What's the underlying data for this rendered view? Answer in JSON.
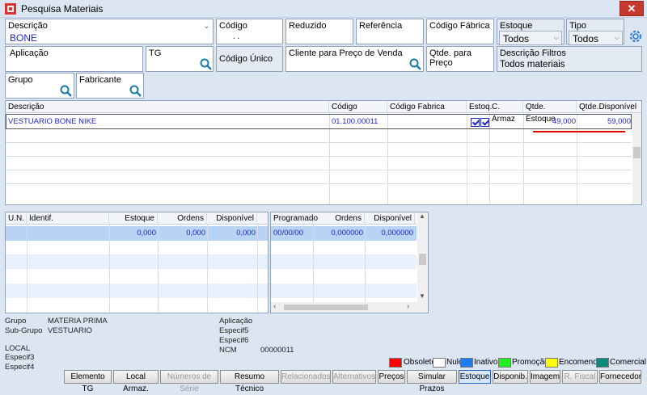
{
  "window": {
    "title": "Pesquisa Materiais",
    "close": "✕"
  },
  "filters": {
    "descricao": {
      "label": "Descrição",
      "value": "BONE"
    },
    "codigo": {
      "label": "Código",
      "value": ". ."
    },
    "reduzido": {
      "label": "Reduzido"
    },
    "referencia": {
      "label": "Referência"
    },
    "codigo_fabrica": {
      "label": "Código Fábrica"
    },
    "estoque": {
      "label": "Estoque",
      "value": "Todos"
    },
    "tipo": {
      "label": "Tipo",
      "value": "Todos"
    },
    "aplicacao": {
      "label": "Aplicação"
    },
    "tg": {
      "label": "TG"
    },
    "codigo_unico": {
      "label": "Código Único"
    },
    "cliente_preco": {
      "label": "Cliente para Preço de Venda"
    },
    "qtde_preco": {
      "label": "Qtde. para Preço"
    },
    "descricao_filtros": {
      "label": "Descrição Filtros",
      "value": "Todos materiais"
    },
    "grupo": {
      "label": "Grupo"
    },
    "fabricante": {
      "label": "Fabricante"
    }
  },
  "results": {
    "headers": [
      "Descrição",
      "Código",
      "Código Fabrica",
      "Estoq.",
      "C. Armaz",
      "Qtde. Estoque",
      "Qtde.Disponível"
    ],
    "rows": [
      {
        "descricao": "VESTUARIO BONE NIKE",
        "codigo": "01.100.00011",
        "codigo_fabrica": "",
        "estoq": true,
        "c_armaz": true,
        "qtde_estoque": "49,000",
        "qtde_disponivel": "59,000"
      }
    ]
  },
  "stock_grid": {
    "headers": [
      "U.N.",
      "Identif.",
      "Estoque",
      "Ordens",
      "Disponível"
    ],
    "row": {
      "un": "",
      "identif": "",
      "estoque": "0,000",
      "ordens": "0,000",
      "disponivel": "0,000"
    }
  },
  "programado_grid": {
    "headers": [
      "Programado",
      "Ordens",
      "Disponível"
    ],
    "row": {
      "programado": "00/00/00",
      "ordens": "0,000000",
      "disponivel": "0,000000"
    }
  },
  "info": {
    "grupo_label": "Grupo",
    "grupo_value": "MATERIA PRIMA",
    "subgrupo_label": "Sub-Grupo",
    "subgrupo_value": "VESTUARIO",
    "local_label": "LOCAL",
    "especif3_label": "Especif3",
    "especif4_label": "Especif4",
    "aplicacao_label": "Aplicação",
    "especif5_label": "Especif5",
    "especif6_label": "Especif6",
    "ncm_label": "NCM",
    "ncm_value": "00000011"
  },
  "legend": [
    {
      "label": "Obsoleto",
      "color": "#ff0000"
    },
    {
      "label": "Nulo",
      "color": "#ffffff"
    },
    {
      "label": "Inativo",
      "color": "#1e7cf5"
    },
    {
      "label": "Promoção",
      "color": "#22ee22"
    },
    {
      "label": "Encomenda",
      "color": "#ffff00"
    },
    {
      "label": "Comercial",
      "color": "#0f8a7a"
    }
  ],
  "buttons": {
    "elemento_tg": "Elemento TG",
    "local_armaz": "Local Armaz.",
    "numeros_serie": "Números de Série",
    "resumo_tecnico": "Resumo Técnico",
    "relacionados": "Relacionados",
    "alternativos": "Alternativos",
    "precos": "Preços",
    "simular_prazos": "Simular Prazos",
    "estoque": "Estoque",
    "disponib": "Disponib.",
    "imagem": "Imagem",
    "r_fiscal": "R. Fiscal",
    "fornecedor": "Fornecedor"
  },
  "colors": {
    "highlight_red": "#e00000",
    "selection": "#b9d3f5",
    "accent_blue": "#1f27c6"
  }
}
